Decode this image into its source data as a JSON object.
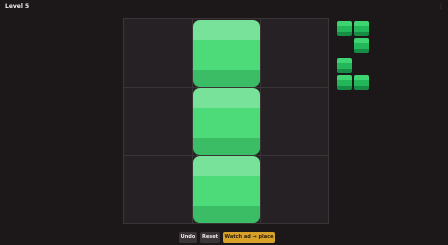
{
  "header": {
    "level_title": "Level 5",
    "menu_glyph": "⋮"
  },
  "board": {
    "rows": 3,
    "cols": 3,
    "cell_color": "#262124",
    "grid_color": "#3a3437",
    "placed_pieces": [
      {
        "row": 0,
        "col": 1,
        "color": "#4ddb7a"
      },
      {
        "row": 1,
        "col": 1,
        "color": "#4ddb7a"
      },
      {
        "row": 2,
        "col": 1,
        "color": "#4ddb7a"
      }
    ]
  },
  "tray": {
    "pieces": [
      {
        "name": "piece-l-shape",
        "color": "#23b75a",
        "cells": [
          [
            0,
            0
          ],
          [
            0,
            1
          ],
          [
            1,
            1
          ]
        ]
      },
      {
        "name": "piece-l-shape-2",
        "color": "#23b75a",
        "cells": [
          [
            0,
            0
          ],
          [
            1,
            0
          ],
          [
            1,
            1
          ]
        ]
      }
    ]
  },
  "footer": {
    "undo_label": "Undo",
    "reset_label": "Reset",
    "watch_ad_label": "Watch ad → place piece",
    "accent_color": "#d7a12a"
  }
}
